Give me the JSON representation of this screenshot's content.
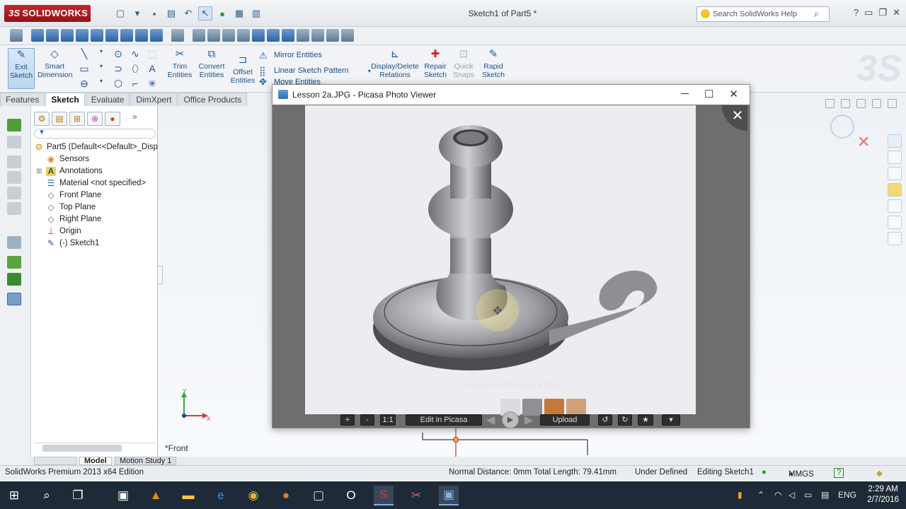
{
  "app": {
    "logo_text": "SOLIDWORKS",
    "logo_prefix": "3S",
    "document_title": "Sketch1 of Part5 *",
    "help_search_placeholder": "Search SolidWorks Help"
  },
  "command_manager": {
    "exit_sketch": "Exit Sketch",
    "smart_dimension": "Smart Dimension",
    "trim_entities": "Trim Entities",
    "convert_entities": "Convert Entities",
    "offset_entities": "Offset Entities",
    "mirror_entities": "Mirror Entities",
    "linear_sketch_pattern": "Linear Sketch Pattern",
    "move_entities": "Move Entities",
    "display_delete_relations": "Display/Delete Relations",
    "repair_sketch": "Repair Sketch",
    "quick_snaps": "Quick Snaps",
    "rapid_sketch": "Rapid Sketch"
  },
  "tabs": [
    "Features",
    "Sketch",
    "Evaluate",
    "DimXpert",
    "Office Products"
  ],
  "active_tab": "Sketch",
  "feature_tree": {
    "part": "Part5  (Default<<Default>_Disp",
    "items": [
      {
        "label": "Sensors",
        "icon": "sensor-icon"
      },
      {
        "label": "Annotations",
        "icon": "annotation-icon"
      },
      {
        "label": "Material <not specified>",
        "icon": "material-icon"
      },
      {
        "label": "Front Plane",
        "icon": "plane-icon"
      },
      {
        "label": "Top Plane",
        "icon": "plane-icon"
      },
      {
        "label": "Right Plane",
        "icon": "plane-icon"
      },
      {
        "label": "Origin",
        "icon": "origin-icon"
      },
      {
        "label": "(-) Sketch1",
        "icon": "sketch-icon"
      }
    ]
  },
  "bottom_tabs": {
    "model": "Model",
    "motion_study": "Motion Study 1"
  },
  "viewport": {
    "view_label": "*Front"
  },
  "picasa": {
    "window_title": "Lesson 2a.JPG - Picasa Photo Viewer",
    "caption": "Lesson 2a.JPG (444 x 369)",
    "zoom_in": "+",
    "zoom_out": "-",
    "actual_size": "1:1",
    "edit_button": "Edit in Picasa",
    "upload_button": "Upload"
  },
  "status": {
    "edition": "SolidWorks Premium 2013 x64 Edition",
    "measure": "Normal Distance: 0mm Total Length: 79.41mm",
    "sketch_state": "Under Defined",
    "editing": "Editing Sketch1",
    "units": "MMGS",
    "units_arrow": "▲",
    "help": "?"
  },
  "taskbar": {
    "language": "ENG",
    "time": "2:29 AM",
    "date": "2/7/2016"
  },
  "colors": {
    "sw_red": "#b31f25",
    "accent_blue": "#1f5aa0",
    "taskbar": "#1f2a38"
  }
}
